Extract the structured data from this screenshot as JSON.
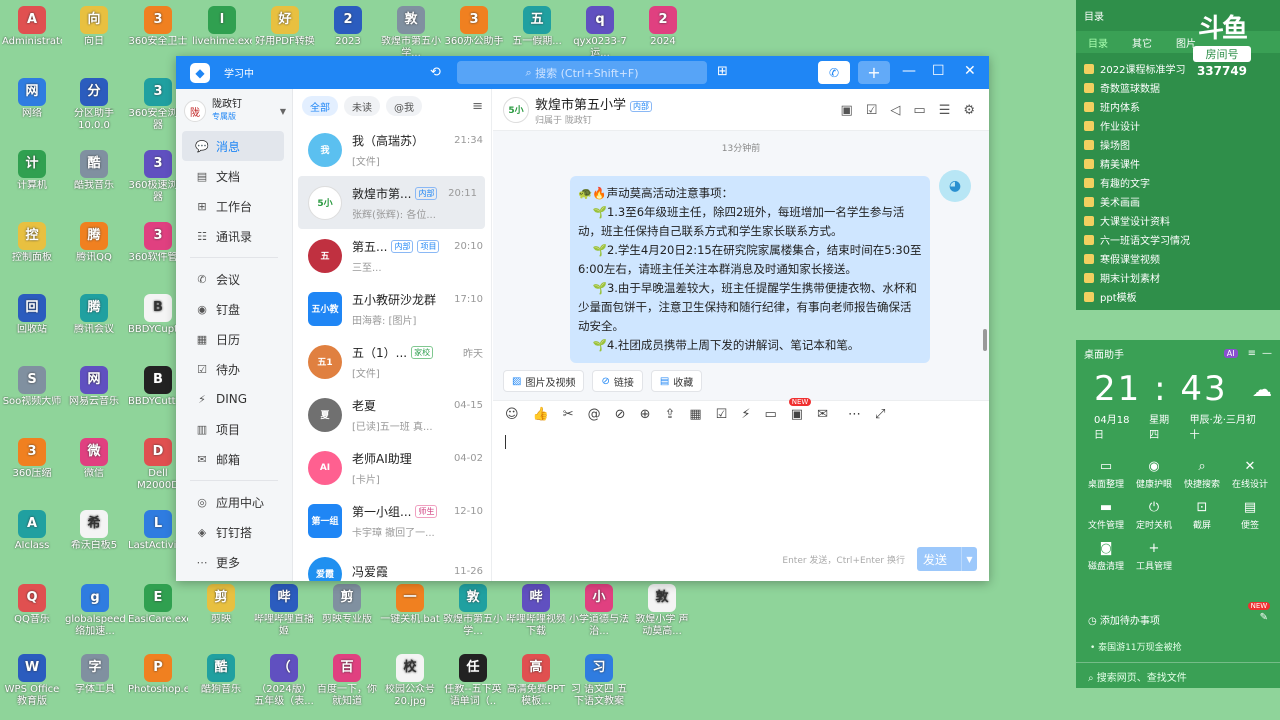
{
  "desktop": {
    "icons_col1": [
      "Administrator",
      "网络",
      "计算机",
      "控制面板",
      "回收站",
      "Soo视频大师",
      "360压缩",
      "AIclass"
    ],
    "icons_col2": [
      "向日",
      "分区助手10.0.0",
      "酷我音乐",
      "腾讯QQ",
      "腾讯会议",
      "网易云音乐",
      "微信",
      "希沃白板5"
    ],
    "icons_col3": [
      "360安全卫士",
      "360安全浏览器",
      "360极速浏览器",
      "360软件管家",
      "BBDYCuptc.exe",
      "BBDYCutt.exe",
      "Dell M2000D",
      "LastActivityView.exe"
    ],
    "icons_top": [
      "livehime.exe",
      "好用PDF转换",
      "2023",
      "敦煌市第五小学...",
      "360办公助手",
      "五一假期...",
      "qyx0233-7运...",
      "2024"
    ],
    "icons_bottom1": [
      "QQ音乐",
      "globalspeed(网络加速...",
      "EasiCare.exe",
      "剪映",
      "哔哩哔哩直播姬",
      "剪映专业版",
      "一键关机.bat",
      "敦煌市第五小学...",
      "哔哩哔哩视频下载",
      "小学道德与法治...",
      "敦煌小学 声动莫高..."
    ],
    "icons_bottom2": [
      "WPS Office 教育版",
      "字体工具",
      "Photoshop.exe",
      "酷狗音乐",
      "（2024版）五年级（表...",
      "百度一下，你就知道",
      "校园公众号20.jpg",
      "任教--五下英语单词（..",
      "高清免费PPT模板...",
      "习 语文四 五下语文教案8..."
    ]
  },
  "app": {
    "status": "学习中",
    "search_placeholder": "搜索 (Ctrl+Shift+F)",
    "org": {
      "name": "陇政钉",
      "badge": "专属版"
    },
    "nav": [
      "消息",
      "文档",
      "工作台",
      "通讯录",
      "会议",
      "钉盘",
      "日历",
      "待办",
      "DING",
      "项目",
      "邮箱",
      "应用中心",
      "钉钉搭",
      "更多"
    ],
    "filters": [
      "全部",
      "未读",
      "@我"
    ],
    "conversations": [
      {
        "name": "我（高瑞苏）",
        "tag": "",
        "time": "21:34",
        "sub": "[文件]",
        "color": "#5bc0f0",
        "initials": "我"
      },
      {
        "name": "敦煌市第...",
        "tag": "内部",
        "time": "20:11",
        "sub": "张辉(张辉): 各位...",
        "color": "#ffffff",
        "initials": "5小"
      },
      {
        "name": "第五...",
        "tag": "内部",
        "tag2": "项目",
        "time": "20:10",
        "sub": "三至...",
        "color": "#c03040",
        "initials": "五"
      },
      {
        "name": "五小教研沙龙群",
        "tag": "",
        "time": "17:10",
        "sub": "田海蓉: [图片]",
        "color": "#1f86f5",
        "initials": "五小教"
      },
      {
        "name": "五（1）...",
        "tag": "家校",
        "time": "昨天",
        "sub": "[文件]",
        "color": "#e08040",
        "initials": "五1"
      },
      {
        "name": "老夏",
        "tag": "",
        "time": "04-15",
        "sub": "[已读]五一班 真...",
        "color": "#707070",
        "initials": "夏"
      },
      {
        "name": "老师AI助理",
        "tag": "",
        "time": "04-02",
        "sub": "[卡片]",
        "color": "#ff6090",
        "initials": "AI"
      },
      {
        "name": "第一小组...",
        "tag": "师生",
        "time": "12-10",
        "sub": "卡宇璋 撤回了一...",
        "color": "#1f86f5",
        "initials": "第一组"
      },
      {
        "name": "冯爱霞",
        "tag": "",
        "time": "11-26",
        "sub": "",
        "color": "#2090f0",
        "initials": "爱霞"
      }
    ],
    "chat": {
      "title": "敦煌市第五小学",
      "tag": "内部",
      "sub": "归属于 陇政钉",
      "timestamp": "13分钟前",
      "message": [
        "声动莫高活动注意事项：",
        "1.3至6年级班主任，除四2班外，每班增加一名学生参与活动，班主任保持自己联系方式和学生家长联系方式。",
        "2.学生4月20日2:15在研究院家属楼集合，结束时间在5:30至6:00左右，请班主任关注本群消息及时通知家长接送。",
        "3.由于早晚温差较大，班主任提醒学生携带便捷衣物、水杯和少量面包饼干，注意卫生保持和随行纪律，有事向老师报告确保活动安全。",
        "4.社团成员携带上周下发的讲解词、笔记本和笔。"
      ],
      "quick": [
        "图片及视频",
        "链接",
        "收藏"
      ],
      "send_hint": "Enter 发送，Ctrl+Enter 换行",
      "send_label": "发送",
      "new_badge": "NEW"
    }
  },
  "right_panel": {
    "title": "目录",
    "tabs": [
      "目录",
      "其它",
      "图片"
    ],
    "folders": [
      "2022课程标准学习",
      "奇数篮球数据",
      "班内体系",
      "作业设计",
      "操场图",
      "精美课件",
      "有趣的文字",
      "美术画画",
      "大课堂设计资料",
      "六一班语文学习情况",
      "寒假课堂视频",
      "期末计划素材",
      "ppt模板"
    ],
    "live": {
      "logo": "斗鱼",
      "room": "房间号",
      "number": "337749"
    }
  },
  "desk_helper": {
    "title": "桌面助手",
    "time": "21 : 43",
    "date": "04月18日",
    "weekday": "星期四",
    "lunar": "甲辰·龙·三月初十",
    "tools": [
      "桌面整理",
      "健康护眼",
      "快捷搜索",
      "在线设计",
      "文件管理",
      "定时关机",
      "截屏",
      "便签",
      "磁盘清理",
      "工具管理"
    ],
    "todo": "添加待办事项",
    "news": "泰国游11万现金被抢",
    "search": "搜索网页、查找文件"
  }
}
